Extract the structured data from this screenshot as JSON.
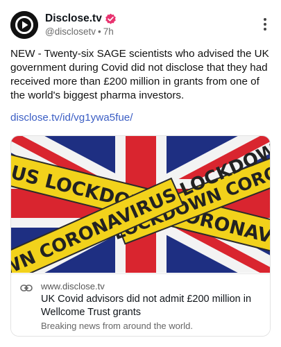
{
  "post": {
    "author_name": "Disclose.tv",
    "handle": "@disclosetv",
    "separator": "•",
    "time": "7h",
    "text": "NEW - Twenty-six SAGE scientists who advised the UK government during Covid did not disclose that they had received more than £200 million in grants from one of the world's biggest pharma investors.",
    "link_text": "disclose.tv/id/vg1ywa5fue/"
  },
  "card": {
    "image_tape_text_1": "RUS LOCKDOWN CORONAVIRUS LOCKD",
    "image_tape_text_2": "LOCKDOWN CORONAVIRUS LOCKDOWN CORO",
    "image_tape_text_3": "WN CORONAVIRUS LOCKDOWN CORONAVI",
    "domain": "www.disclose.tv",
    "title": "UK Covid advisors did not admit £200 million in Wellcome Trust grants",
    "description": "Breaking news from around the world."
  },
  "colors": {
    "verified_badge": "#e8336f",
    "link": "#3b5ec4",
    "flag_blue": "#1e2f82",
    "flag_red": "#d9252f",
    "tape_yellow": "#f2d21b"
  },
  "icons": {
    "avatar": "play-logo-icon",
    "verified": "verified-badge-icon",
    "more": "more-vertical-icon",
    "link": "link-chain-icon"
  }
}
